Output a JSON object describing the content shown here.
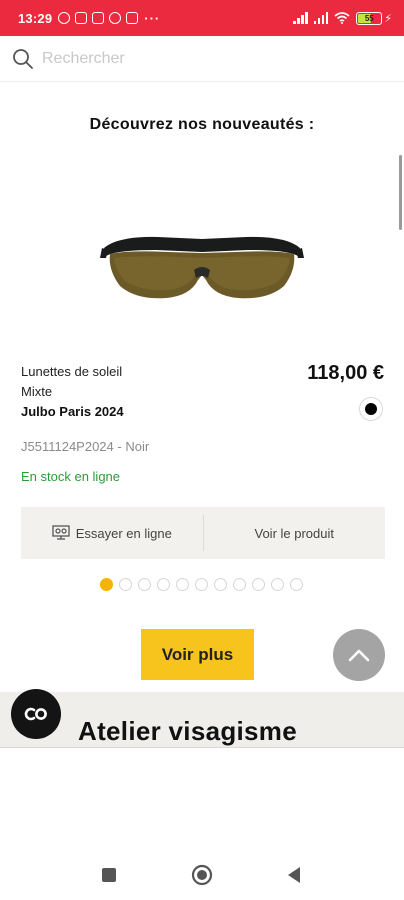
{
  "status_bar": {
    "time": "13:29",
    "more_indicator": "···",
    "battery_level": "55",
    "icons": [
      "alarm-icon",
      "gallery-icon",
      "photo-icon",
      "facebook-icon",
      "gmail-icon",
      "signal-icon",
      "wifi-icon",
      "battery-icon",
      "charging-icon"
    ]
  },
  "search": {
    "placeholder": "Rechercher"
  },
  "section": {
    "heading": "Découvrez nos nouveautés :"
  },
  "product": {
    "category": "Lunettes de soleil",
    "gender": "Mixte",
    "name": "Julbo Paris 2024",
    "price": "118,00 €",
    "reference": "J5511124P2024 - Noir",
    "stock": "En stock en ligne",
    "color": "#000000",
    "stock_color": "#2c9b3c"
  },
  "actions": {
    "try_online": "Essayer en ligne",
    "view_product": "Voir le produit"
  },
  "carousel": {
    "total": 11,
    "active_index": 0
  },
  "buttons": {
    "voir_plus": "Voir plus"
  },
  "next_section": {
    "title": "Atelier visagisme"
  },
  "chat": {
    "label": "CO"
  },
  "colors": {
    "brand_red": "#ec2a3f",
    "accent_yellow": "#f7c31d",
    "pager_active": "#f5b400"
  }
}
